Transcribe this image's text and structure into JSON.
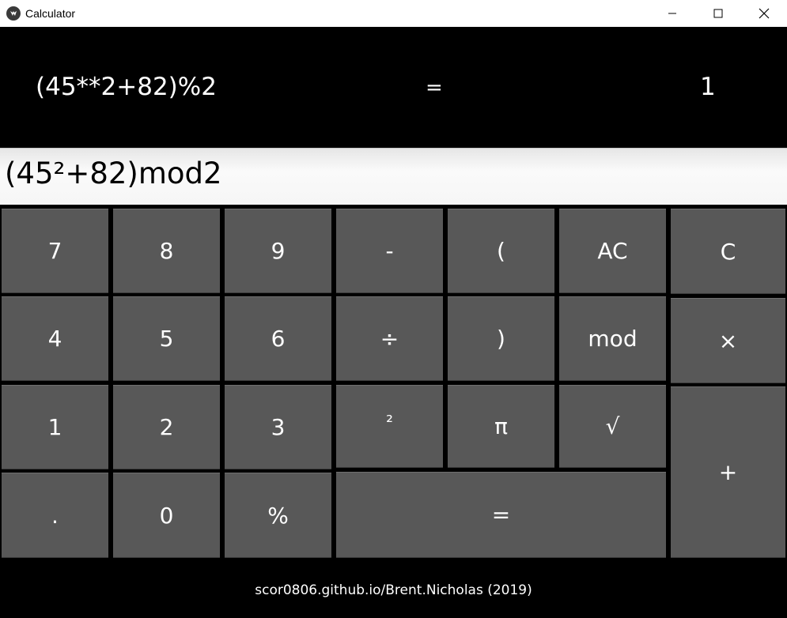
{
  "window": {
    "title": "Calculator",
    "icon": "kivy-logo-icon"
  },
  "display": {
    "expression": "(45**2+82)%2",
    "equals": "=",
    "result": "1"
  },
  "input": {
    "value": "(45²+82)mod2"
  },
  "keys": {
    "k7": "7",
    "k8": "8",
    "k9": "9",
    "minus": "-",
    "lparen": "(",
    "ac": "AC",
    "c": "C",
    "k4": "4",
    "k5": "5",
    "k6": "6",
    "divide": "÷",
    "rparen": ")",
    "mod": "mod",
    "multiply": "×",
    "k1": "1",
    "k2": "2",
    "k3": "3",
    "square": "²",
    "pi": "π",
    "sqrt": "√",
    "plus": "+",
    "dot": ".",
    "k0": "0",
    "percent": "%",
    "equals": "="
  },
  "footer": {
    "credit": "scor0806.github.io/Brent.Nicholas (2019)"
  }
}
